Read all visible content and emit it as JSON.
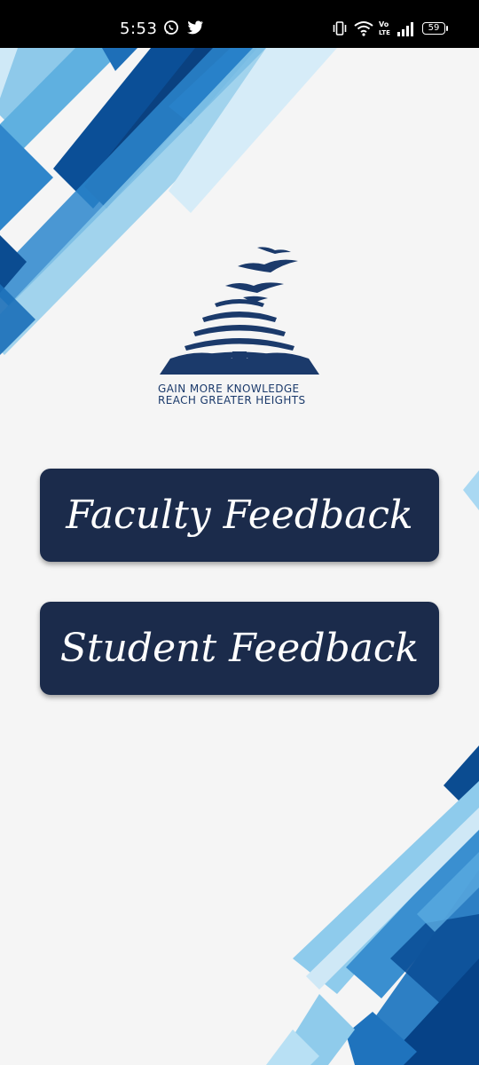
{
  "status_bar": {
    "time": "5:53",
    "battery": "59",
    "icons": [
      "whatsapp-icon",
      "twitter-icon",
      "vibrate-icon",
      "wifi-icon",
      "volte-icon",
      "signal-icon",
      "battery-icon"
    ]
  },
  "logo": {
    "line1": "GAIN  MORE  KNOWLEDGE",
    "line2": "REACH GREATER HEIGHTS",
    "color": "#1b3a6b"
  },
  "buttons": {
    "faculty_label": "Faculty Feedback",
    "student_label": "Student Feedback"
  },
  "colors": {
    "button_bg": "#1b2b4b",
    "background": "#f5f5f5",
    "deco_dark": "#0a4c91",
    "deco_mid": "#2b7bc3",
    "deco_light": "#9dd1ee"
  }
}
